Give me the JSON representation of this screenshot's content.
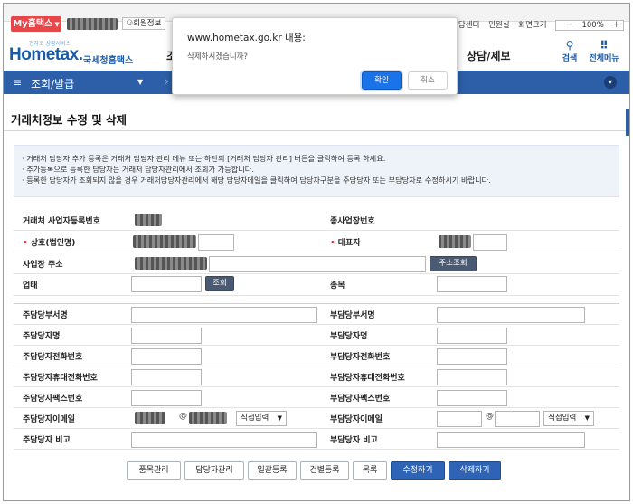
{
  "topbar": {
    "myhome_label": "My홈택스",
    "member_info_label": "회원정보",
    "util_items": [
      "국세상담센터",
      "민원실"
    ],
    "screen_size_label": "화면크기",
    "zoom_label": "100%"
  },
  "header": {
    "logo_small": "전자로 상황서비스",
    "logo_main": "Hometax.",
    "logo_sub": "국세청홈택스",
    "menu_partial": "조",
    "menu_consult": "상담/제보",
    "search_label": "검색",
    "all_menu_label": "전체메뉴"
  },
  "navbar": {
    "crumb": "조회/발급"
  },
  "page": {
    "title": "거래처정보 수정 및 삭제"
  },
  "notice": {
    "lines": [
      "· 거래처 담당자 추가 등록은 거래처 담당자 관리 메뉴 또는 하단의 [거래처 담당자 관리] 버튼을 클릭하여 등록 하세요.",
      "· 추가등록으로 등록한 담당자는 거래처 담당자관리에서 조회가 가능합니다.",
      "· 등록한 담당자가 조회되지 않을 경우 거래처담당자관리에서 해당 담당자메일을 클릭하여 담당자구분을 주담당자 또는 부담당자로 수정하시기 바랍니다."
    ]
  },
  "form": {
    "biz_reg_no": "거래처 사업자등록번호",
    "branch_no": "종사업장번호",
    "company_name": "상호(법인명)",
    "representative": "대표자",
    "address": "사업장 주소",
    "address_search": "주소조회",
    "business_type": "업태",
    "lookup": "조회",
    "business_item": "종목",
    "main_dept": "주담당부서명",
    "sub_dept": "부담당부서명",
    "main_name": "주담당자명",
    "sub_name": "부담당자명",
    "main_phone": "주담당자전화번호",
    "sub_phone": "부담당자전화번호",
    "main_mobile": "주담당자휴대전화번호",
    "sub_mobile": "부담당자휴대전화번호",
    "main_fax": "주담당자팩스번호",
    "sub_fax": "부담당자팩스번호",
    "main_email": "주담당자이메일",
    "sub_email": "부담당자이메일",
    "email_at": "@",
    "direct_input": "직접입력",
    "main_note": "주담당자 비고",
    "sub_note": "부담당자 비고"
  },
  "buttons": {
    "item_manage": "품목관리",
    "contact_manage": "담당자관리",
    "bulk_register": "일괄등록",
    "single_register": "건별등록",
    "list": "목록",
    "modify": "수정하기",
    "delete": "삭제하기"
  },
  "dialog": {
    "title": "www.hometax.go.kr 내용:",
    "message": "삭제하시겠습니까?",
    "ok": "확인",
    "cancel": "취소"
  }
}
